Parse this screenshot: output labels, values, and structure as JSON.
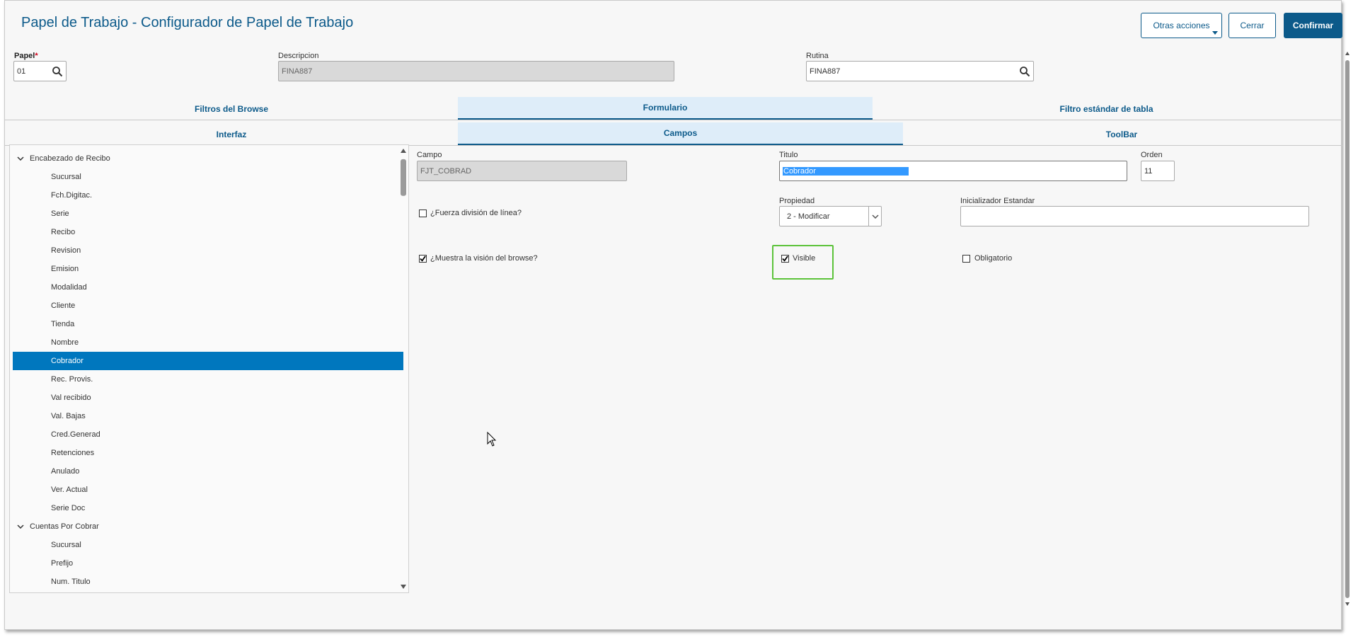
{
  "window": {
    "title": "Papel de Trabajo - Configurador de Papel de Trabajo"
  },
  "actions": {
    "other_label": "Otras acciones",
    "close_label": "Cerrar",
    "confirm_label": "Confirmar"
  },
  "header_fields": {
    "papel_label": "Papel",
    "papel_required": "*",
    "papel_value": "01",
    "descripcion_label": "Descripcion",
    "descripcion_value": "FINA887",
    "rutina_label": "Rutina",
    "rutina_value": "FINA887"
  },
  "tabs_main": [
    "Filtros del Browse",
    "Formulario",
    "Filtro estándar de tabla"
  ],
  "tabs_main_active": "Formulario",
  "tabs_sub": [
    "Interfaz",
    "Campos",
    "ToolBar"
  ],
  "tabs_sub_active": "Campos",
  "tree": {
    "groups": [
      {
        "label": "Encabezado de Recibo",
        "items": [
          "Sucursal",
          "Fch.Digitac.",
          "Serie",
          "Recibo",
          "Revision",
          "Emision",
          "Modalidad",
          "Cliente",
          "Tienda",
          "Nombre",
          "Cobrador",
          "Rec. Provis.",
          "Val recibido",
          "Val. Bajas",
          "Cred.Generad",
          "Retenciones",
          "Anulado",
          "Ver. Actual",
          "Serie Doc"
        ]
      },
      {
        "label": "Cuentas Por Cobrar",
        "items": [
          "Sucursal",
          "Prefijo",
          "Num. Titulo"
        ]
      }
    ],
    "selected": "Cobrador"
  },
  "form": {
    "campo_label": "Campo",
    "campo_value": "FJT_COBRAD",
    "titulo_label": "Titulo",
    "titulo_value": "Cobrador",
    "orden_label": "Orden",
    "orden_value": "11",
    "propiedad_label": "Propiedad",
    "propiedad_value": "2 - Modificar",
    "inicializador_label": "Inicializador Estandar",
    "inicializador_value": "",
    "fuerza_label": "¿Fuerza división de línea?",
    "fuerza_checked": false,
    "muestra_label": "¿Muestra la visión del browse?",
    "muestra_checked": true,
    "visible_label": "Visible",
    "visible_checked": true,
    "obligatorio_label": "Obligatorio",
    "obligatorio_checked": false
  },
  "colors": {
    "brand": "#0c5a8a",
    "selection": "#0077be",
    "highlight": "#5cc33a"
  }
}
